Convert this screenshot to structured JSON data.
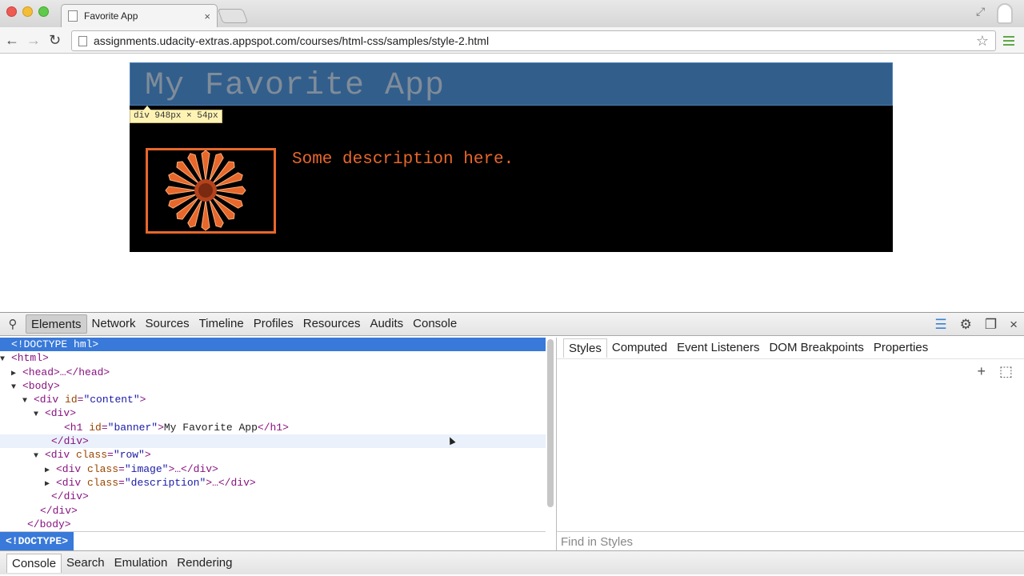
{
  "browser": {
    "tab_title": "Favorite App",
    "tab_close": "×",
    "url": "assignments.udacity-extras.appspot.com/courses/html-css/samples/style-2.html",
    "back_icon": "←",
    "forward_icon": "→",
    "reload_icon": "↻",
    "star_icon": "☆"
  },
  "page": {
    "banner_title": "My Favorite App",
    "size_tip": "div 948px × 54px",
    "description": "Some description here.",
    "banner_color": "#325e8c",
    "accent_color": "#e8672b"
  },
  "devtools": {
    "tabs": [
      "Elements",
      "Network",
      "Sources",
      "Timeline",
      "Profiles",
      "Resources",
      "Audits",
      "Console"
    ],
    "active_tab": "Elements",
    "dom": {
      "line0": "<!DOCTYPE hml>",
      "line1_tag": "<html>",
      "line2_tag": "<head>…</head>",
      "line3_tag": "<body>",
      "line4_open": "<div ",
      "line4_attr": "id",
      "line4_val": "\"content\"",
      "line5_tag": "<div>",
      "line6_open": "<h1 ",
      "line6_attr": "id",
      "line6_val": "\"banner\"",
      "line6_text": "My Favorite App",
      "line6_close": "</h1>",
      "line7_tag": "</div>",
      "line8_open": "<div ",
      "line8_attr": "class",
      "line8_val": "\"row\"",
      "line9_open": "<div ",
      "line9_attr": "class",
      "line9_val": "\"image\"",
      "line9_close": ">…</div>",
      "line10_open": "<div ",
      "line10_attr": "class",
      "line10_val": "\"description\"",
      "line10_close": ">…</div>",
      "line11_tag": "</div>",
      "line12_tag": "</div>",
      "line13_tag": "</body>"
    },
    "breadcrumb": "<!DOCTYPE>",
    "sidebar_tabs": [
      "Styles",
      "Computed",
      "Event Listeners",
      "DOM Breakpoints",
      "Properties"
    ],
    "find_in_styles_placeholder": "Find in Styles",
    "drawer_tabs": [
      "Console",
      "Search",
      "Emulation",
      "Rendering"
    ],
    "add_rule_icon": "+",
    "close_icon": "×"
  }
}
